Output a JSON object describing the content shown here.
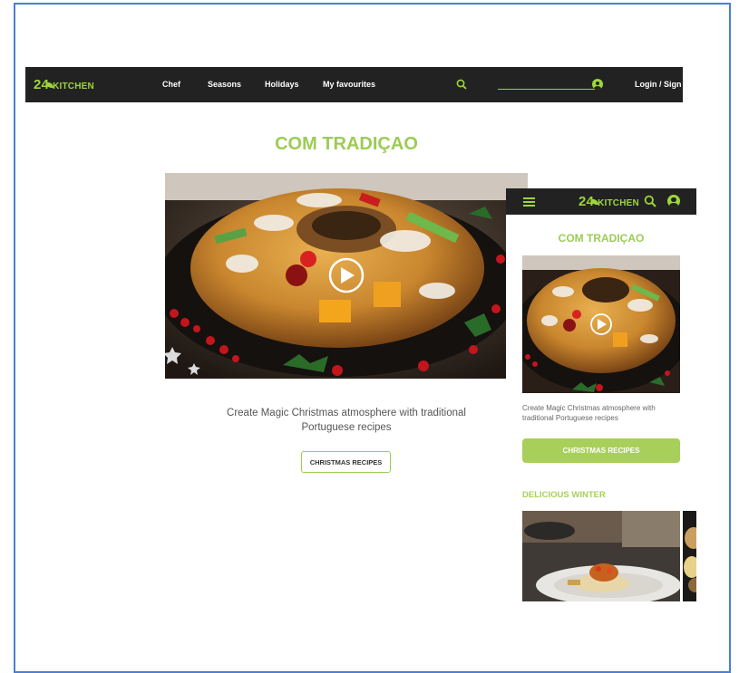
{
  "brand": {
    "logo_number": "24",
    "logo_text": "KITCHEN"
  },
  "nav": {
    "items": [
      "Chef",
      "Seasons",
      "Holidays",
      "My favourites"
    ],
    "search_placeholder": "",
    "login_label": "Login / Sign in"
  },
  "hero": {
    "title": "COM TRADIÇAO",
    "description": "Create Magic Christmas atmosphere with traditional Portuguese recipes",
    "button_label": "CHRISTMAS RECIPES"
  },
  "mobile": {
    "title": "COM TRADIÇAO",
    "description": "Create Magic Christmas atmosphere with traditional Portuguese recipes",
    "button_label": "CHRISTMAS RECIPES",
    "section_title": "DELICIOUS WINTER"
  },
  "colors": {
    "accent": "#9ccc55",
    "navbar": "#222222",
    "frame_border": "#4a7fd6"
  }
}
